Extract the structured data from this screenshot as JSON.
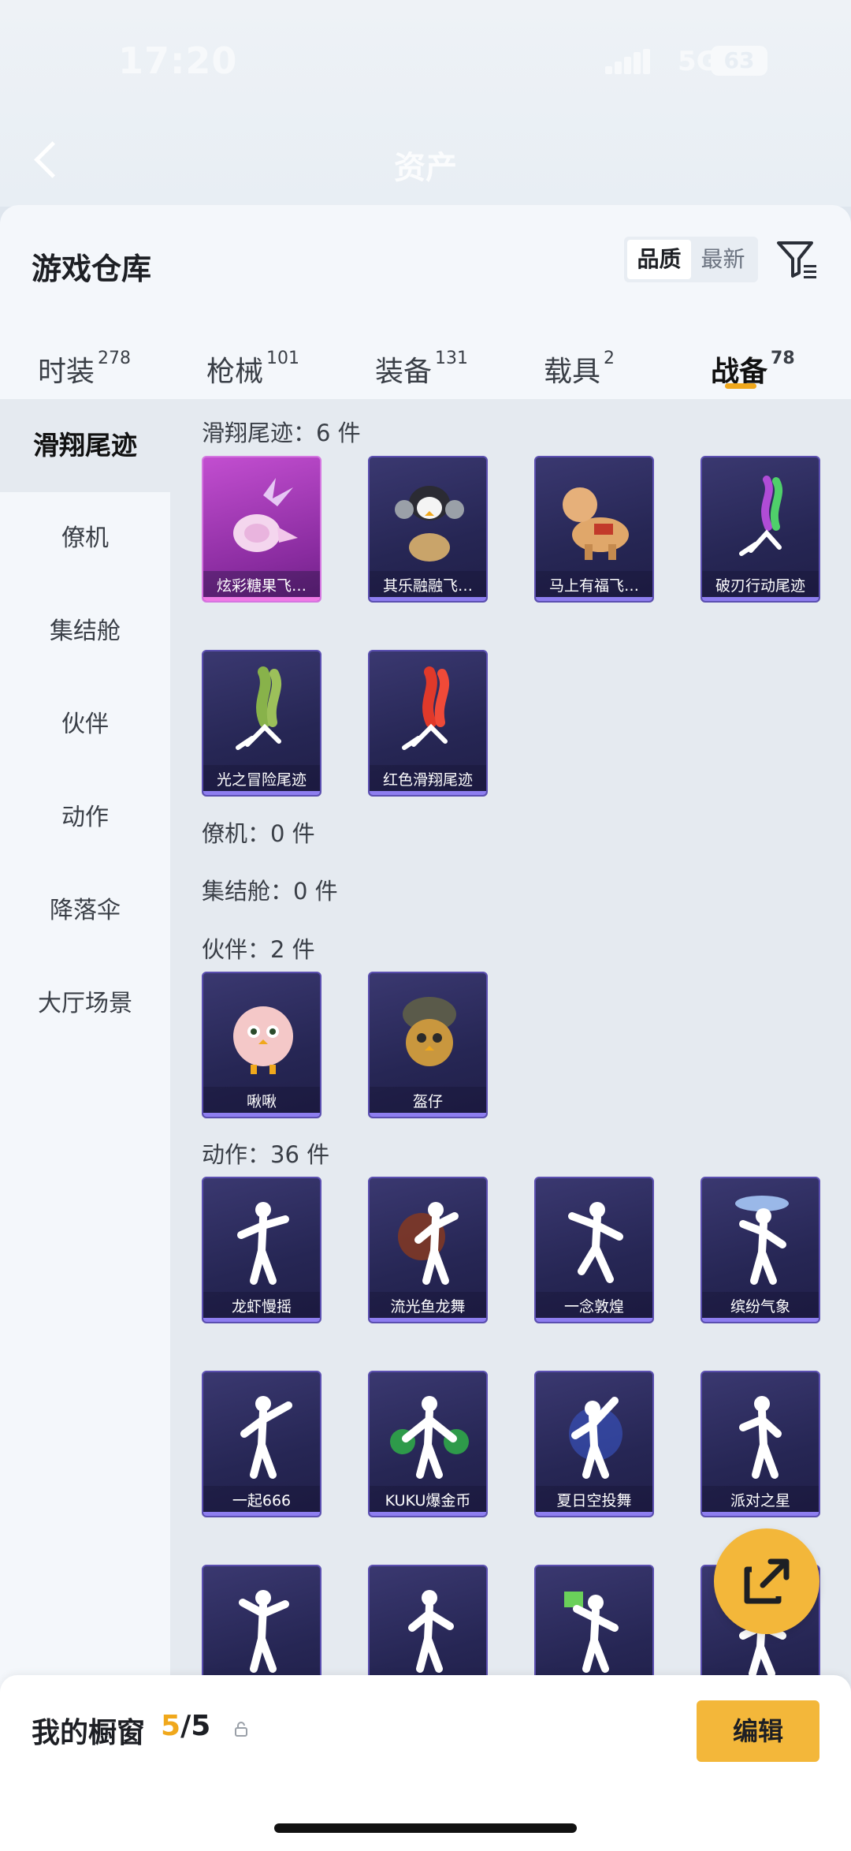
{
  "status": {
    "time": "17:20",
    "network": "5G",
    "battery": "63"
  },
  "header": {
    "title": "资产"
  },
  "sheet": {
    "title": "游戏仓库",
    "sort_options": [
      "品质",
      "最新"
    ],
    "tabs": [
      {
        "label": "时装",
        "count": "278"
      },
      {
        "label": "枪械",
        "count": "101"
      },
      {
        "label": "装备",
        "count": "131"
      },
      {
        "label": "载具",
        "count": "2"
      },
      {
        "label": "战备",
        "count": "78"
      }
    ]
  },
  "categories": [
    "滑翔尾迹",
    "僚机",
    "集结舱",
    "伙伴",
    "动作",
    "降落伞",
    "大厅场景"
  ],
  "sections": {
    "trail": {
      "label": "滑翔尾迹：6 件",
      "items": [
        "炫彩糖果飞…",
        "其乐融融飞…",
        "马上有福飞…",
        "破刃行动尾迹",
        "光之冒险尾迹",
        "红色滑翔尾迹"
      ]
    },
    "wingman": {
      "label": "僚机：0 件"
    },
    "pod": {
      "label": "集结舱：0 件"
    },
    "partner": {
      "label": "伙伴：2 件",
      "items": [
        "啾啾",
        "盔仔"
      ]
    },
    "emote": {
      "label": "动作：36 件",
      "items": [
        "龙虾慢摇",
        "流光鱼龙舞",
        "一念敦煌",
        "缤纷气象",
        "一起666",
        "KUKU爆金币",
        "夏日空投舞",
        "派对之星",
        "",
        "",
        "",
        ""
      ]
    }
  },
  "showcase": {
    "title": "我的橱窗",
    "used": "5",
    "total": "5",
    "edit_label": "编辑"
  },
  "colors": {
    "accent": "#f3b73a",
    "card": "#2a2a5c"
  }
}
